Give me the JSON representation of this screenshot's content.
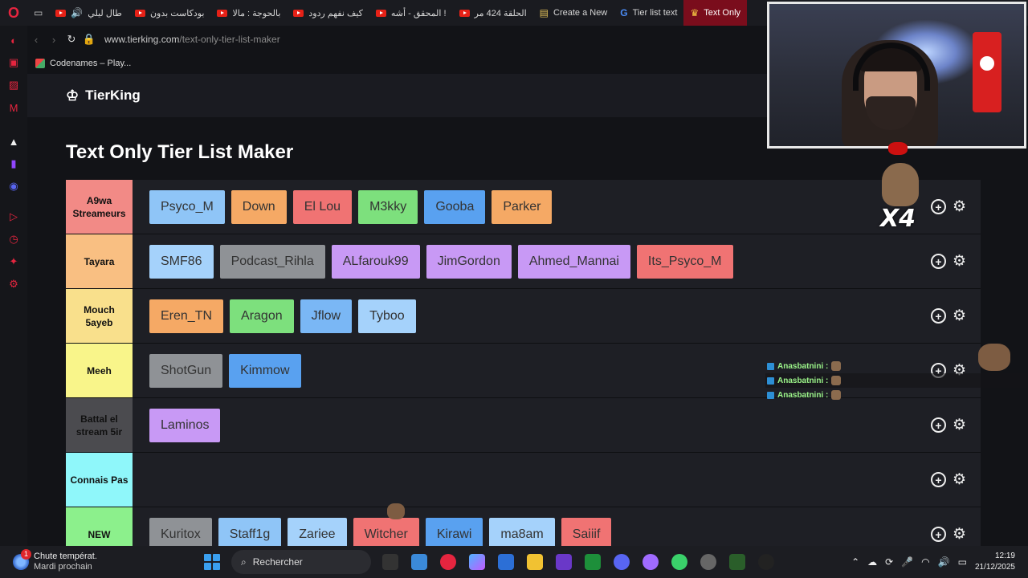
{
  "browser": {
    "tabs": [
      {
        "label": "طال ليلي",
        "type": "youtube"
      },
      {
        "label": "بودكاست بدون",
        "type": "youtube"
      },
      {
        "label": "بالحوجة : مالا",
        "type": "youtube"
      },
      {
        "label": "كيف نفهم ردود",
        "type": "youtube"
      },
      {
        "label": "المحقق - أشه !",
        "type": "youtube"
      },
      {
        "label": "الحلقة 424 مر",
        "type": "youtube"
      },
      {
        "label": "Create a New",
        "type": "doc"
      },
      {
        "label": "Tier list text",
        "type": "google"
      },
      {
        "label": "Text Only",
        "type": "tierking"
      }
    ],
    "url": {
      "host": "www.tierking.com",
      "path": "/text-only-tier-list-maker"
    },
    "bookmark": "Codenames – Play..."
  },
  "site": {
    "brand": "TierKing",
    "page_title": "Text Only Tier List Maker"
  },
  "tiers": [
    {
      "label": "A9wa Streameurs",
      "color": "#f28a86",
      "items": [
        {
          "text": "Psyco_M",
          "color": "#8fc5f7"
        },
        {
          "text": "Down",
          "color": "#f5a965"
        },
        {
          "text": "El Lou",
          "color": "#f07373"
        },
        {
          "text": "M3kky",
          "color": "#7de07d"
        },
        {
          "text": "Gooba",
          "color": "#59a1f0"
        },
        {
          "text": "Parker",
          "color": "#f5a965"
        }
      ]
    },
    {
      "label": "Tayara",
      "color": "#f9bf82",
      "items": [
        {
          "text": "SMF86",
          "color": "#a5d2fb"
        },
        {
          "text": "Podcast_Rihla",
          "color": "#8f9296"
        },
        {
          "text": "ALfarouk99",
          "color": "#c899f5"
        },
        {
          "text": "JimGordon",
          "color": "#c899f5"
        },
        {
          "text": "Ahmed_Mannai",
          "color": "#c899f5"
        },
        {
          "text": "Its_Psyco_M",
          "color": "#f07373"
        }
      ]
    },
    {
      "label": "Mouch 5ayeb",
      "color": "#f9e08c",
      "items": [
        {
          "text": "Eren_TN",
          "color": "#f5a965"
        },
        {
          "text": "Aragon",
          "color": "#7de07d"
        },
        {
          "text": "Jflow",
          "color": "#7ab7f5"
        },
        {
          "text": "Tyboo",
          "color": "#a5d2fb"
        }
      ]
    },
    {
      "label": "Meeh",
      "color": "#f9f58a",
      "items": [
        {
          "text": "ShotGun",
          "color": "#8f9296"
        },
        {
          "text": "Kimmow",
          "color": "#59a1f0"
        }
      ]
    },
    {
      "label": "Battal el stream 5ir",
      "color": "#4b4b4f",
      "items": [
        {
          "text": "Laminos",
          "color": "#c899f5"
        }
      ]
    },
    {
      "label": "Connais Pas",
      "color": "#8ff7fa",
      "items": []
    },
    {
      "label": "NEW",
      "color": "#8cf08c",
      "items": [
        {
          "text": "Kuritox",
          "color": "#8f9296"
        },
        {
          "text": "Staff1g",
          "color": "#8fc5f7"
        },
        {
          "text": "Zariee",
          "color": "#a5d2fb"
        },
        {
          "text": "Witcher",
          "color": "#f07373"
        },
        {
          "text": "Kirawi",
          "color": "#59a1f0"
        },
        {
          "text": "ma8am",
          "color": "#a5d2fb"
        },
        {
          "text": "Saiiif",
          "color": "#f07373"
        }
      ]
    }
  ],
  "overlay": {
    "sticker_text": "X4",
    "chat": [
      {
        "user": "Anasbatnini :"
      },
      {
        "user": "Anasbatnini :"
      },
      {
        "user": "Anasbatnini :"
      }
    ]
  },
  "taskbar": {
    "weather_title": "Chute températ.",
    "weather_sub": "Mardi prochain",
    "weather_badge": "1",
    "search_placeholder": "Rechercher",
    "time": "12:19",
    "date": "21/12/2025"
  }
}
